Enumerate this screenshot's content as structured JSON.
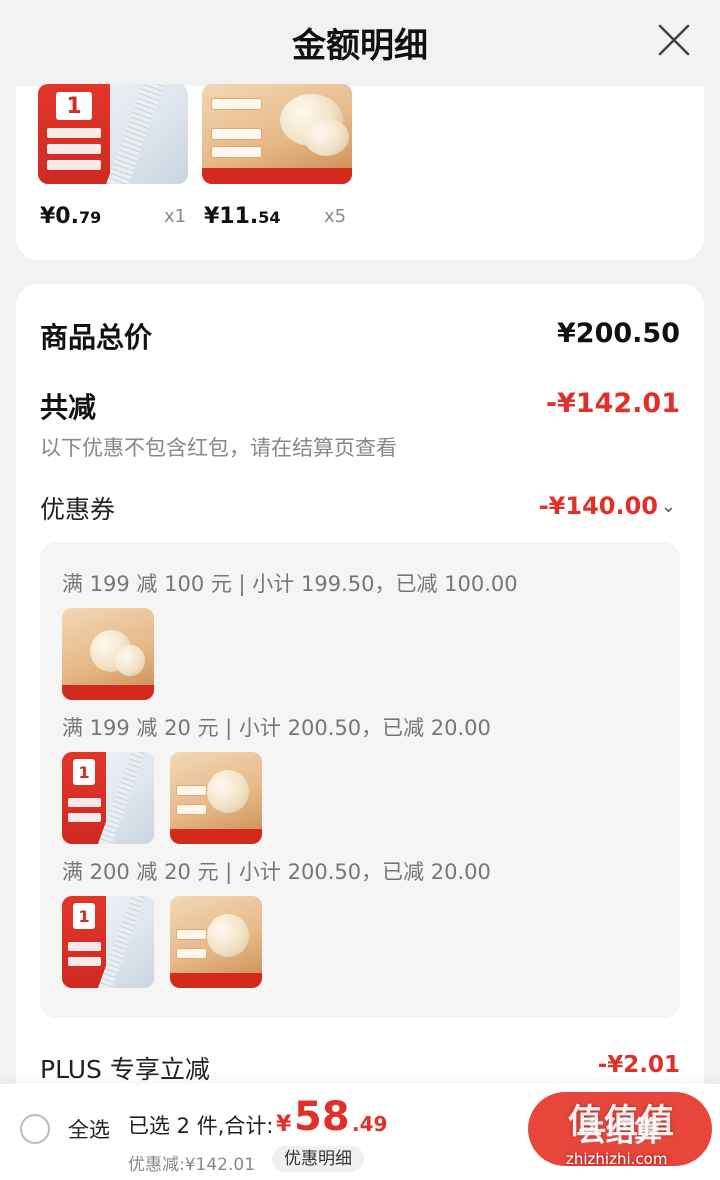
{
  "header": {
    "title": "金额明细",
    "close_icon": "close-icon"
  },
  "items": [
    {
      "price_main": "¥0.",
      "price_cents": "79",
      "qty": "x1"
    },
    {
      "price_main": "¥11.",
      "price_cents": "54",
      "qty": "x5"
    }
  ],
  "summary": {
    "goods_total_label": "商品总价",
    "goods_total_value": "¥200.50",
    "total_reduction_label": "共减",
    "total_reduction_value": "-¥142.01",
    "note": "以下优惠不包含红包，请在结算页查看",
    "coupon_label": "优惠券",
    "coupon_value": "-¥140.00",
    "coupon_toggle_icon": "chevron-down-icon",
    "plus_label": "PLUS 专享立减",
    "plus_value": "-¥2.01"
  },
  "coupons": [
    {
      "line": "满 199 减 100 元 | 小计 199.50，已减 100.00"
    },
    {
      "line": "满 199 减 20 元 | 小计 200.50，已减 20.00"
    },
    {
      "line": "满 200 减 20 元 | 小计 200.50，已减 20.00"
    }
  ],
  "bottom": {
    "select_all": "全选",
    "selected_info": "已选 2 件,合计:",
    "currency": "¥",
    "total_main": "58",
    "total_cents": ".49",
    "discount_info": "优惠减:¥142.01",
    "detail_chip": "优惠明细",
    "checkout_label": "去结算",
    "watermark": "值值值",
    "watermark_url": "zhizhizhi.com"
  },
  "colors": {
    "accent_red": "#e0302a",
    "checkout_button": "#e8453b"
  }
}
